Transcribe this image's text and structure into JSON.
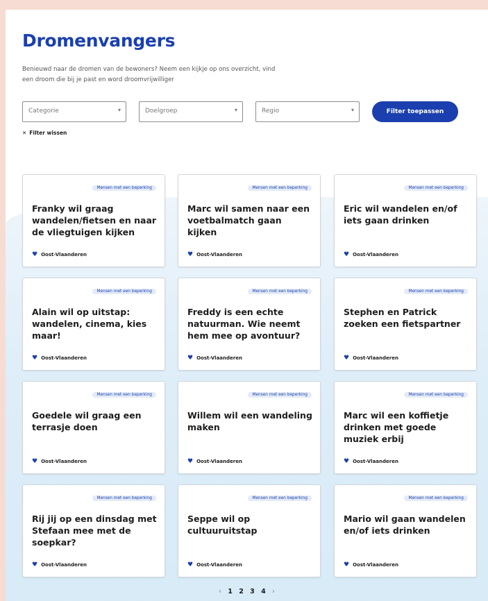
{
  "title": "Dromenvangers",
  "intro": "Benieuwd naar de dromen van de bewoners? Neem een kijkje op ons overzicht, vind een droom die bij je past en word droomvrijwilliger",
  "filters": {
    "category": "Categorie",
    "target": "Doelgroep",
    "region": "Regio",
    "apply_label": "Filter toepassen",
    "clear_label": "Filter wissen"
  },
  "cards": [
    {
      "badge": "Mensen met een beperking",
      "title": "Franky wil graag wandelen/fietsen en naar de vliegtuigen kijken",
      "region": "Oost-Vlaanderen"
    },
    {
      "badge": "Mensen met een beperking",
      "title": "Marc wil samen naar een voetbalmatch gaan kijken",
      "region": "Oost-Vlaanderen"
    },
    {
      "badge": "Mensen met een beperking",
      "title": "Eric wil wandelen en/of iets gaan drinken",
      "region": "Oost-Vlaanderen"
    },
    {
      "badge": "Mensen met een beperking",
      "title": "Alain wil op uitstap: wandelen, cinema, kies maar!",
      "region": "Oost-Vlaanderen"
    },
    {
      "badge": "Mensen met een beperking",
      "title": "Freddy is een echte natuurman. Wie neemt hem mee op avontuur?",
      "region": "Oost-Vlaanderen"
    },
    {
      "badge": "Mensen met een beperking",
      "title": "Stephen en Patrick zoeken een fietspartner",
      "region": "Oost-Vlaanderen"
    },
    {
      "badge": "Mensen met een beperking",
      "title": "Goedele wil graag een terrasje doen",
      "region": "Oost-Vlaanderen"
    },
    {
      "badge": "Mensen met een beperking",
      "title": "Willem wil een wandeling maken",
      "region": "Oost-Vlaanderen"
    },
    {
      "badge": "Mensen met een beperking",
      "title": "Marc wil een koffietje drinken met goede muziek erbij",
      "region": "Oost-Vlaanderen"
    },
    {
      "badge": "Mensen met een beperking",
      "title": "Rij jij op een dinsdag met Stefaan mee met de soepkar?",
      "region": "Oost-Vlaanderen"
    },
    {
      "badge": "Mensen met een beperking",
      "title": "Seppe wil op cultuuruitstap",
      "region": "Oost-Vlaanderen"
    },
    {
      "badge": "Mensen met een beperking",
      "title": "Mario wil gaan wandelen en/of iets drinken",
      "region": "Oost-Vlaanderen"
    }
  ],
  "pagination": {
    "prev": "‹",
    "pages": [
      "1",
      "2",
      "3",
      "4"
    ],
    "next": "›"
  },
  "icons": {
    "region": "heart-icon",
    "select": "chevron-down-icon",
    "clear": "close-icon"
  },
  "colors": {
    "brand": "#1b3fae",
    "badge_bg": "#e3ebf8",
    "frame": "#f7dcd3"
  }
}
